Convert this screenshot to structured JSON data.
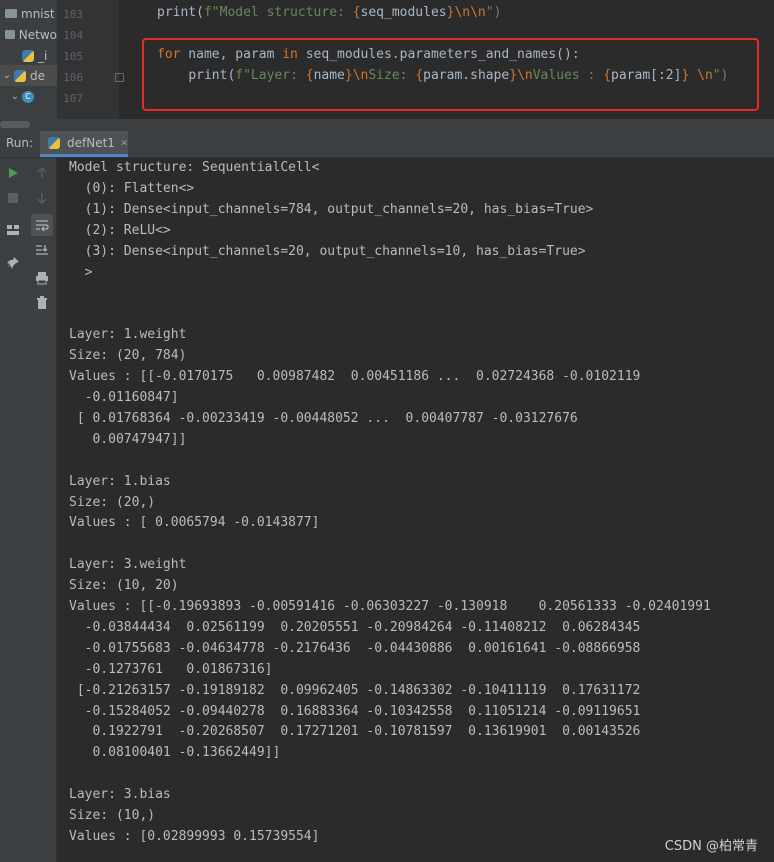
{
  "project_tree": {
    "items": [
      {
        "label": "mnist"
      },
      {
        "label": "Netwo"
      },
      {
        "label": "_i"
      },
      {
        "label": "de"
      },
      {
        "label": "C"
      }
    ]
  },
  "editor": {
    "line_numbers": [
      "103",
      "104",
      "105",
      "106",
      "107"
    ],
    "code_line_103": {
      "fn": "print(",
      "prefix": "f\"Model structure: ",
      "brace_open": "{",
      "var": "seq_modules",
      "brace_close": "}",
      "escape": "\\n\\n",
      "suffix": "\")"
    },
    "code_line_105": {
      "kw_for": "for",
      "part1": " name, param ",
      "kw_in": "in",
      "part2": " seq_modules.parameters_and_names():"
    },
    "code_line_106": {
      "indent": "    ",
      "fn": "print(",
      "s1": "f\"Layer: ",
      "b1o": "{",
      "v1": "name",
      "b1c": "}",
      "e1": "\\n",
      "s2": "Size: ",
      "b2o": "{",
      "v2": "param.shape",
      "b2c": "}",
      "e2": "\\n",
      "s3": "Values : ",
      "b3o": "{",
      "v3": "param[:2]",
      "b3c": "}",
      "s4": " ",
      "e3": "\\n",
      "s5": "\")"
    }
  },
  "run_panel": {
    "label": "Run:",
    "tab_label": "defNet1",
    "close_icon": "×"
  },
  "toolbar_icons": [
    "run-icon",
    "stop-icon",
    "layout-icon",
    "pin-icon",
    "up-arrow-icon",
    "down-arrow-icon",
    "soft-wrap-icon",
    "scroll-to-end-icon",
    "print-icon",
    "trash-icon"
  ],
  "console": {
    "output": "Model structure: SequentialCell<\n  (0): Flatten<>\n  (1): Dense<input_channels=784, output_channels=20, has_bias=True>\n  (2): ReLU<>\n  (3): Dense<input_channels=20, output_channels=10, has_bias=True>\n  >\n\n\nLayer: 1.weight\nSize: (20, 784)\nValues : [[-0.0170175   0.00987482  0.00451186 ...  0.02724368 -0.0102119\n  -0.01160847]\n [ 0.01768364 -0.00233419 -0.00448052 ...  0.00407787 -0.03127676\n   0.00747947]]\n\nLayer: 1.bias\nSize: (20,)\nValues : [ 0.0065794 -0.0143877]\n\nLayer: 3.weight\nSize: (10, 20)\nValues : [[-0.19693893 -0.00591416 -0.06303227 -0.130918    0.20561333 -0.02401991\n  -0.03844434  0.02561199  0.20205551 -0.20984264 -0.11408212  0.06284345\n  -0.01755683 -0.04634778 -0.2176436  -0.04430886  0.00161641 -0.08866958\n  -0.1273761   0.01867316]\n [-0.21263157 -0.19189182  0.09962405 -0.14863302 -0.10411119  0.17631172\n  -0.15284052 -0.09440278  0.16883364 -0.10342558  0.11051214 -0.09119651\n   0.1922791  -0.20268507  0.17271201 -0.10781597  0.13619901  0.00143526\n   0.08100401 -0.13662449]]\n\nLayer: 3.bias\nSize: (10,)\nValues : [0.02899993 0.15739554]"
  },
  "watermark": "CSDN @柏常青",
  "colors": {
    "keyword": "#cc7832",
    "string": "#6a8759",
    "variable": "#94558d",
    "highlight_border": "#e52c2c",
    "run_icon": "#499c54"
  }
}
